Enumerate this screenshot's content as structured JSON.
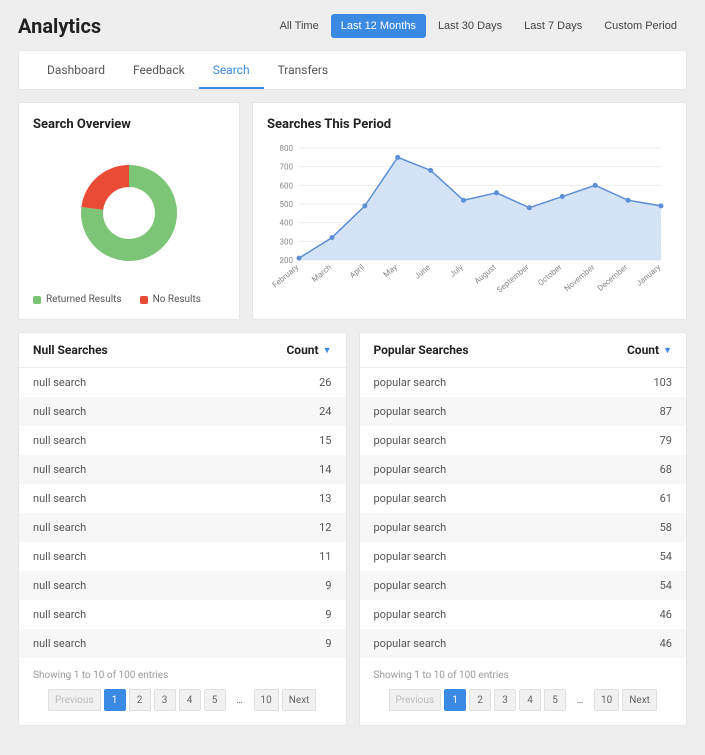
{
  "title": "Analytics",
  "period_bar": {
    "items": [
      "All Time",
      "Last 12 Months",
      "Last 30 Days",
      "Last 7 Days",
      "Custom Period"
    ],
    "active_index": 1
  },
  "tabs": {
    "items": [
      "Dashboard",
      "Feedback",
      "Search",
      "Transfers"
    ],
    "active_index": 2
  },
  "overview": {
    "title": "Search Overview",
    "legend": {
      "returned": "Returned Results",
      "no_results": "No Results"
    },
    "donut": {
      "returned_pct": 77,
      "no_results_pct": 23
    }
  },
  "chart_data": {
    "type": "area",
    "title": "Searches This Period",
    "xlabel": "",
    "ylabel": "",
    "categories": [
      "February",
      "March",
      "April",
      "May",
      "June",
      "July",
      "August",
      "September",
      "October",
      "November",
      "December",
      "January"
    ],
    "values": [
      210,
      320,
      490,
      750,
      680,
      520,
      560,
      480,
      540,
      600,
      520,
      490
    ],
    "ylim": [
      200,
      800
    ],
    "yticks": [
      200,
      300,
      400,
      500,
      600,
      700,
      800
    ],
    "series_name": "Searches"
  },
  "null_table": {
    "title": "Null Searches",
    "count_header": "Count",
    "rows": [
      {
        "label": "null search",
        "count": 26
      },
      {
        "label": "null search",
        "count": 24
      },
      {
        "label": "null search",
        "count": 15
      },
      {
        "label": "null search",
        "count": 14
      },
      {
        "label": "null search",
        "count": 13
      },
      {
        "label": "null search",
        "count": 12
      },
      {
        "label": "null search",
        "count": 11
      },
      {
        "label": "null search",
        "count": 9
      },
      {
        "label": "null search",
        "count": 9
      },
      {
        "label": "null search",
        "count": 9
      }
    ],
    "footer_info": "Showing 1 to 10 of 100 entries",
    "pager": {
      "prev": "Previous",
      "next": "Next",
      "pages": [
        "1",
        "2",
        "3",
        "4",
        "5"
      ],
      "last": "10",
      "active_index": 0
    }
  },
  "popular_table": {
    "title": "Popular Searches",
    "count_header": "Count",
    "rows": [
      {
        "label": "popular search",
        "count": 103
      },
      {
        "label": "popular search",
        "count": 87
      },
      {
        "label": "popular search",
        "count": 79
      },
      {
        "label": "popular search",
        "count": 68
      },
      {
        "label": "popular search",
        "count": 61
      },
      {
        "label": "popular search",
        "count": 58
      },
      {
        "label": "popular search",
        "count": 54
      },
      {
        "label": "popular search",
        "count": 54
      },
      {
        "label": "popular search",
        "count": 46
      },
      {
        "label": "popular search",
        "count": 46
      }
    ],
    "footer_info": "Showing 1 to 10 of 100 entries",
    "pager": {
      "prev": "Previous",
      "next": "Next",
      "pages": [
        "1",
        "2",
        "3",
        "4",
        "5"
      ],
      "last": "10",
      "active_index": 0
    }
  }
}
